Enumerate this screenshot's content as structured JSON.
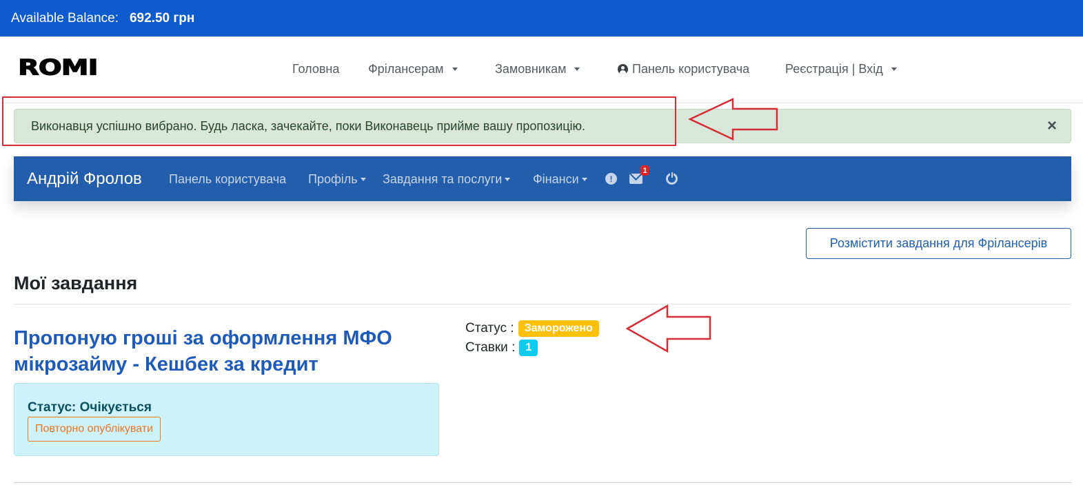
{
  "balance": {
    "label": "Available Balance:",
    "amount": "692.50 грн"
  },
  "brand": {
    "logo_text": "ROMI"
  },
  "top_nav": {
    "home": "Головна",
    "freelancers": "Фрілансерам",
    "customers": "Замовникам",
    "user_panel": "Панель користувача",
    "auth": "Реєстрація | Вхід"
  },
  "alert": {
    "message": "Виконавця успішно вибрано. Будь ласка, зачекайте, поки Виконавець прийме вашу пропозицію.",
    "close": "×"
  },
  "user_nav": {
    "name": "Андрій Фролов",
    "dashboard": "Панель користувача",
    "profile": "Профіль",
    "tasks": "Завдання та послуги",
    "finance": "Фінанси",
    "info_icon": "!",
    "messages_count": "1"
  },
  "post_task_button": "Розмістити завдання для Фрілансерів",
  "section_title": "Мої завдання",
  "task": {
    "title": "Пропоную гроші за оформлення МФО мікрозайму - Кешбек за кредит",
    "status_label": "Статус : ",
    "status_value": "Заморожено",
    "bids_label": "Ставки : ",
    "bids_value": "1",
    "card_status": "Статус: Очікується",
    "republish": "Повторно опублікувати"
  },
  "colors": {
    "balance_bar": "#0d5bcc",
    "user_nav": "#225eab",
    "alert_bg": "#d9e7da",
    "annotation": "#d62c34",
    "status_badge": "#ffc107",
    "bids_badge": "#0dcaf0"
  },
  "icons": [
    "user-circle-icon",
    "caret-down-icon",
    "close-icon",
    "info-icon",
    "envelope-icon",
    "power-icon",
    "arrow-left-annotation"
  ]
}
